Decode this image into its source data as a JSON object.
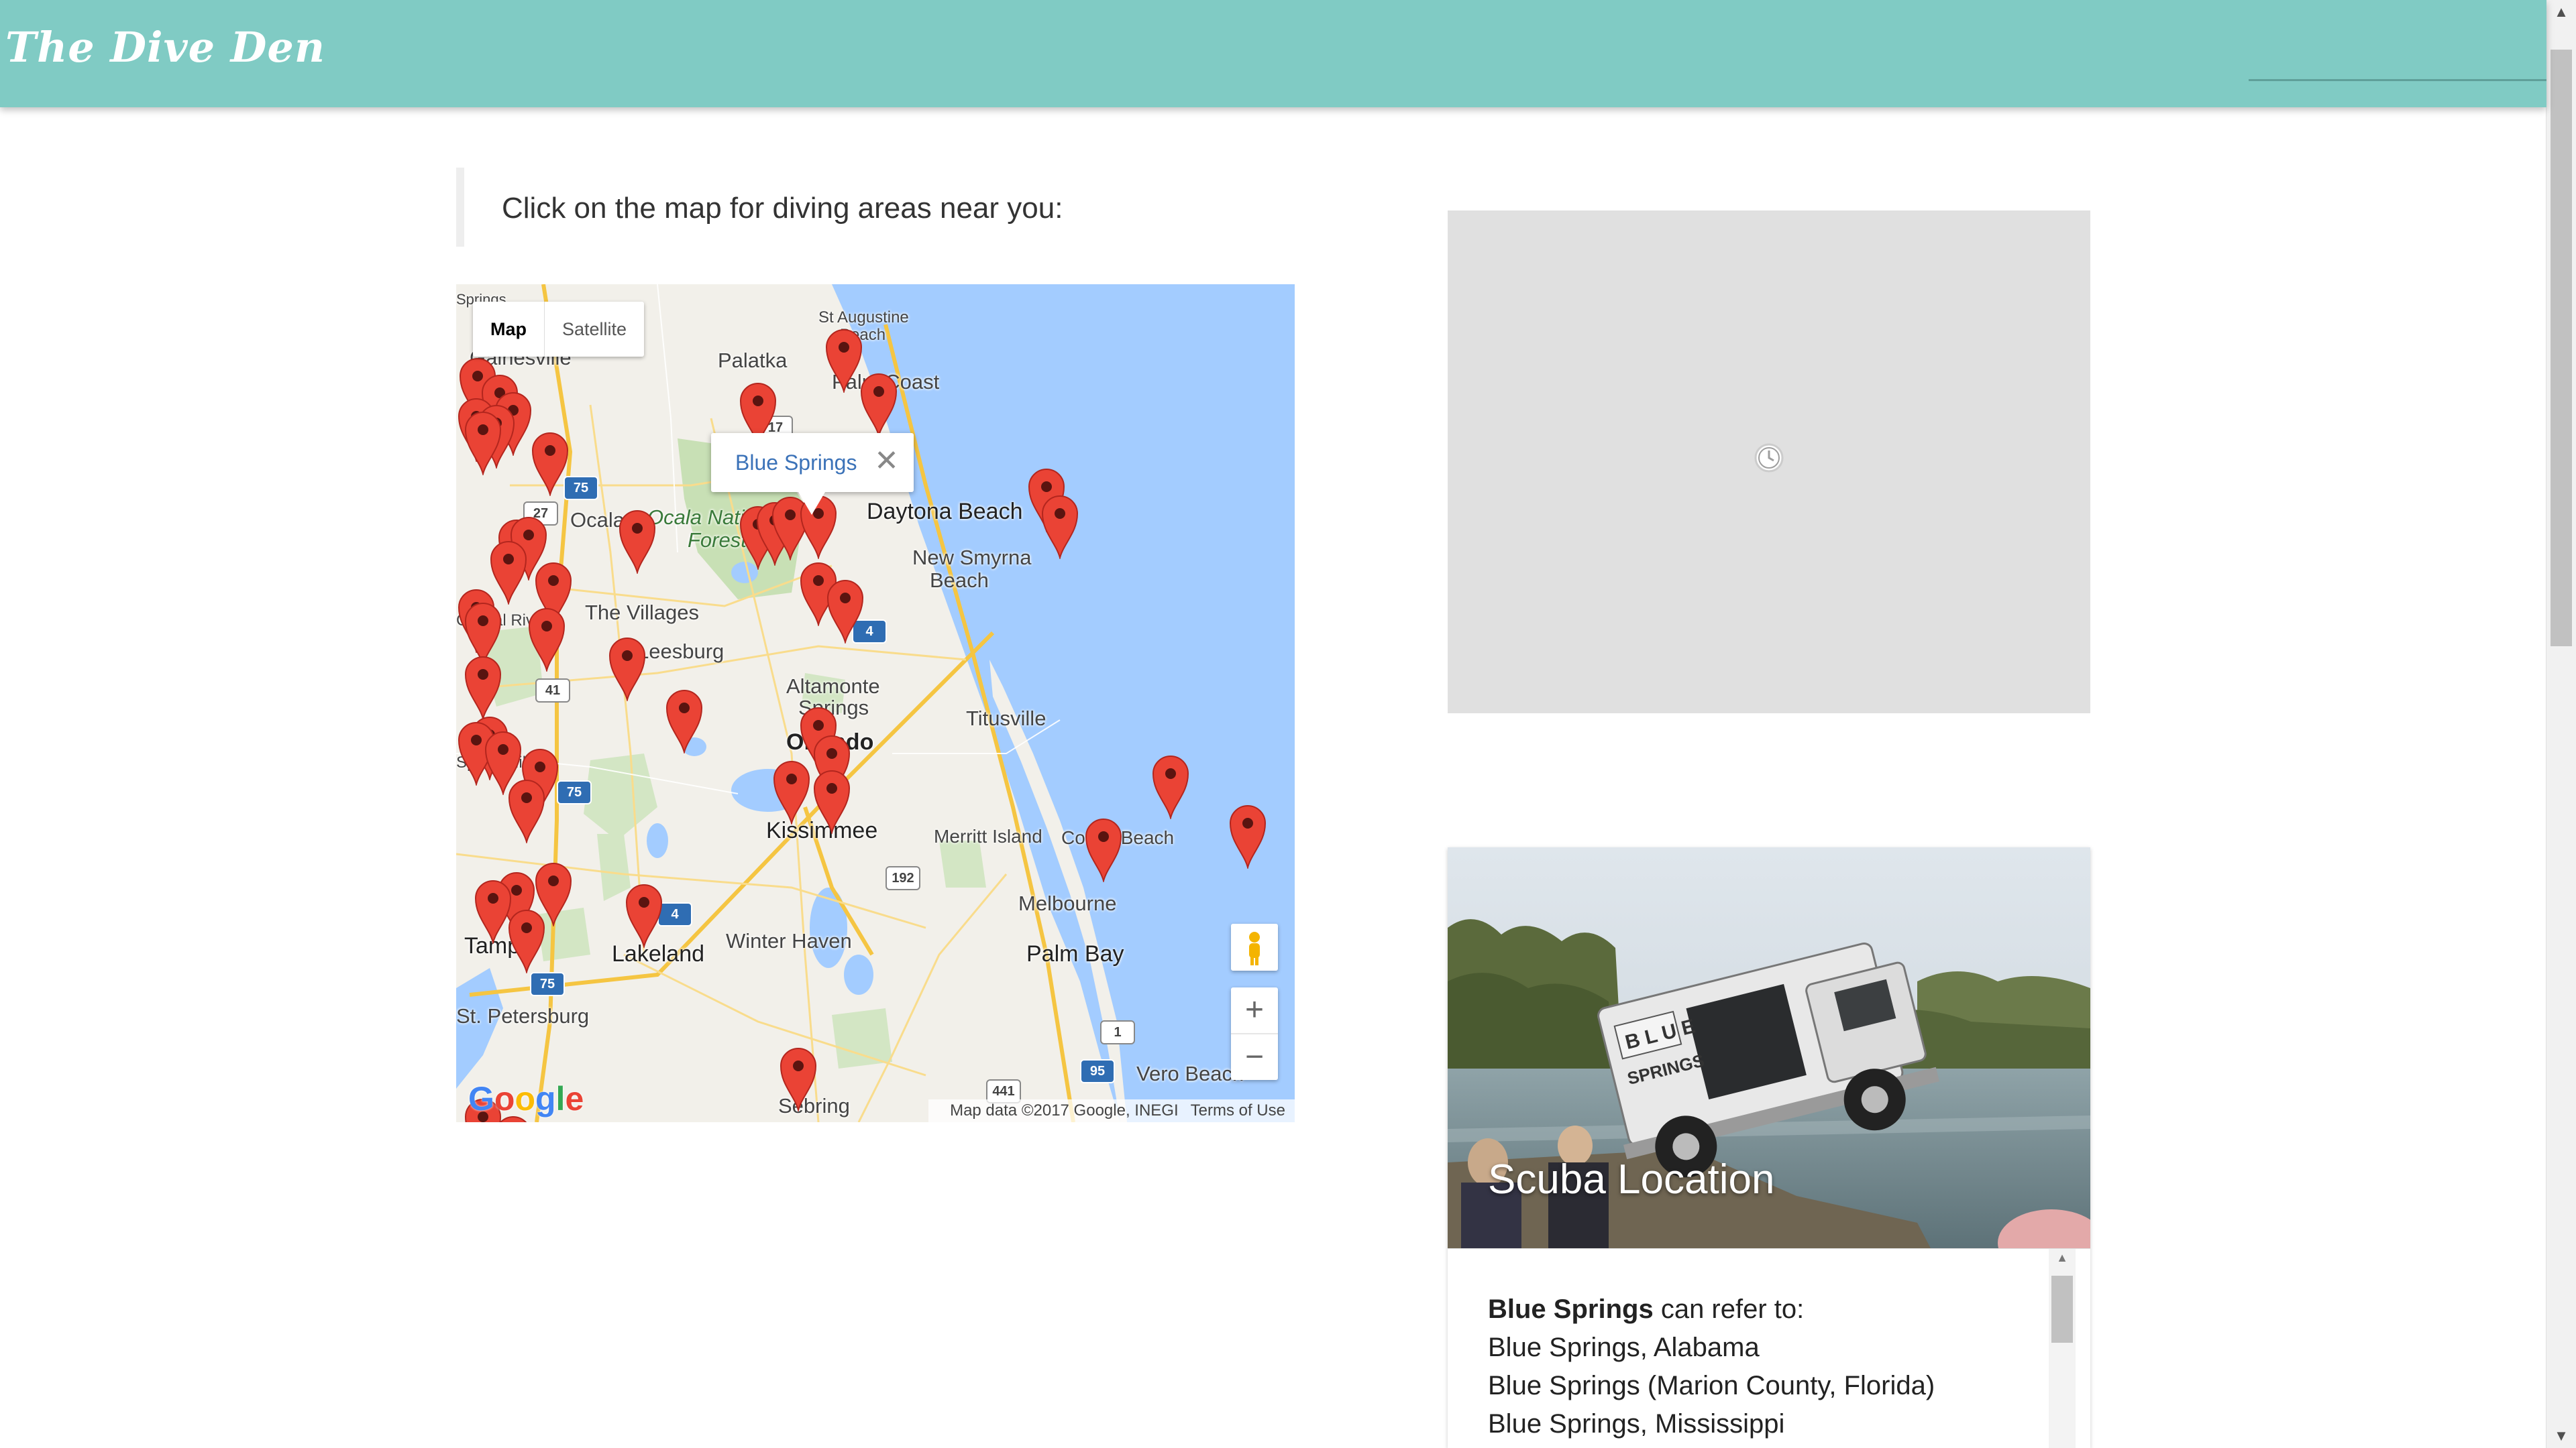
{
  "header": {
    "brand": "The Dive Den"
  },
  "intro": {
    "text": "Click on the map for diving areas near you:"
  },
  "map": {
    "type_buttons": [
      "Map",
      "Satellite"
    ],
    "selected_type": "Map",
    "infowindow": {
      "title": "Blue Springs",
      "close_symbol": "✕"
    },
    "zoom_in_symbol": "+",
    "zoom_out_symbol": "−",
    "google_logo": "Google",
    "attribution": {
      "data": "Map data ©2017 Google, INEGI",
      "terms": "Terms of Use"
    },
    "labels": {
      "st_augustine": "St Augustine",
      "beach": "Beach",
      "palatka": "Palatka",
      "palm_coast": "Palm Coast",
      "ocala_national": "Ocala National",
      "forest": "Forest",
      "daytona": "Daytona Beach",
      "new_smyrna": "New Smyrna",
      "new_smyrna_beach": "Beach",
      "villages": "The Villages",
      "leesburg": "Leesburg",
      "altamonte": "Altamonte",
      "springs": "Springs",
      "orlando": "Orlando",
      "titusville": "Titusville",
      "kissimmee": "Kissimmee",
      "merritt": "Merritt Island",
      "cocoa_beach": "Cocoa Beach",
      "melbourne": "Melbourne",
      "palm_bay": "Palm Bay",
      "winter_haven": "Winter Haven",
      "lakeland": "Lakeland",
      "tampa": "Tampa",
      "sebring": "Sebring",
      "vero": "Vero Beach",
      "stpete": "St. Petersburg",
      "ocala": "Ocala",
      "crystal_river": "Crystal River",
      "spring_hill": "Spring Hill",
      "gainesville": "Gainesville",
      "springs_top": "Springs"
    },
    "route_shields": [
      "17",
      "75",
      "27",
      "4",
      "41",
      "75",
      "192",
      "4",
      "75",
      "1",
      "95",
      "441"
    ]
  },
  "card": {
    "title": "Scuba Location",
    "bold_term": "Blue Springs",
    "lead": " can refer to:",
    "lines": [
      "Blue Springs, Alabama",
      "Blue Springs (Marion County, Florida)",
      "Blue Springs, Mississippi"
    ]
  },
  "colors": {
    "header": "#80cbc4",
    "pin": "#ea4335",
    "water": "#a3ccff",
    "link": "#3b72b8"
  },
  "icons": [
    "loading-clock-icon",
    "pegman-icon",
    "map-pin-icon",
    "close-icon",
    "scroll-up-arrow-icon",
    "scroll-down-arrow-icon"
  ]
}
